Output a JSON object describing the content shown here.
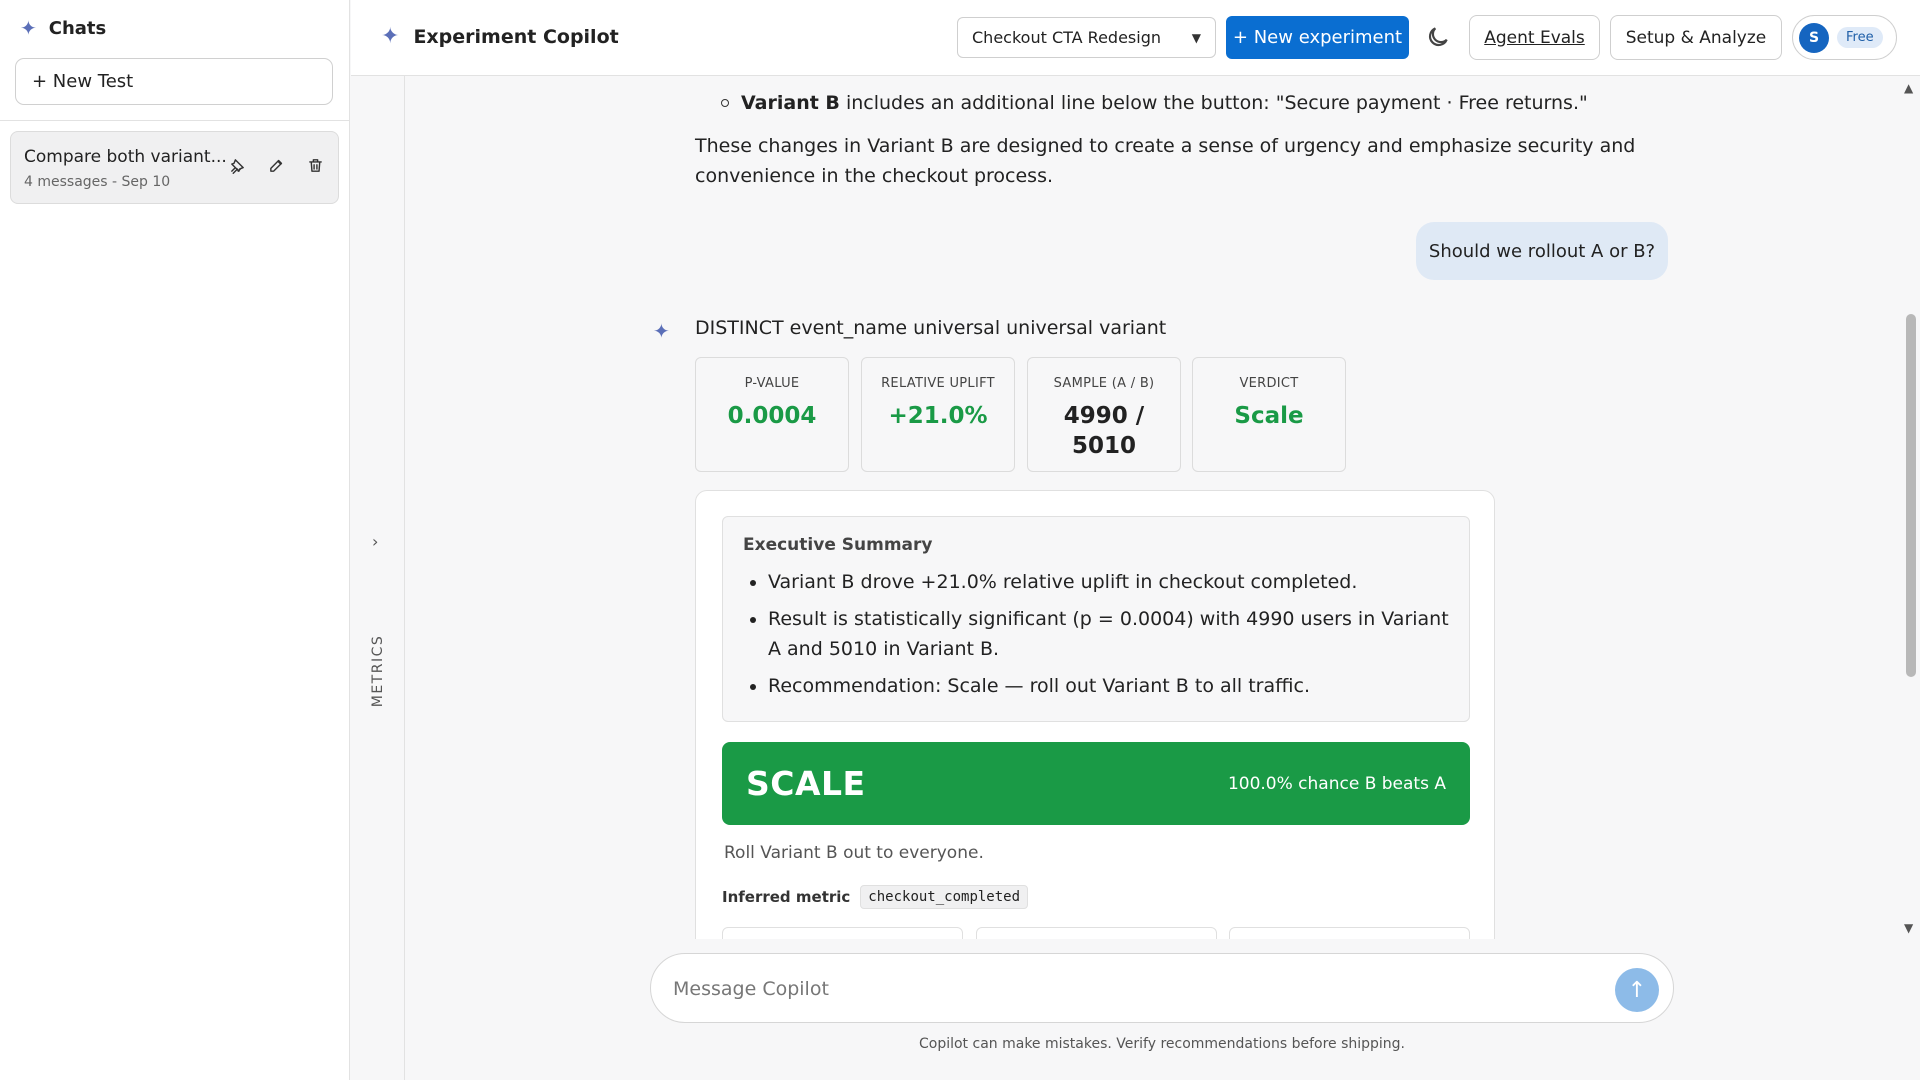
{
  "sidebar": {
    "title": "Chats",
    "new_test_label": "+ New Test",
    "chats": [
      {
        "title": "Compare both variant...",
        "subtitle": "4 messages - Sep 10"
      }
    ]
  },
  "rail": {
    "label": "METRICS",
    "chevron": "›"
  },
  "topbar": {
    "title": "Experiment Copilot",
    "experiment_select": "Checkout CTA Redesign",
    "new_experiment_label": "+ New experiment",
    "agent_evals_label": "Agent Evals",
    "setup_label": "Setup & Analyze",
    "avatar_initial": "S",
    "plan_badge": "Free"
  },
  "chat": {
    "variant_b_name": "Variant B",
    "variant_b_desc": " includes an additional line below the button: \"Secure payment · Free returns.\"",
    "summary_paragraph": "These changes in Variant B are designed to create a sense of urgency and emphasize security and convenience in the checkout process.",
    "user_message": "Should we rollout A or B?",
    "assistant_heading": "DISTINCT event_name universal universal variant",
    "stats": [
      {
        "label": "P-VALUE",
        "value": "0.0004"
      },
      {
        "label": "RELATIVE UPLIFT",
        "value": "+21.0%"
      },
      {
        "label": "SAMPLE (A / B)",
        "value": "4990 / 5010"
      },
      {
        "label": "VERDICT",
        "value": "Scale"
      }
    ],
    "executive_summary": {
      "title": "Executive Summary",
      "bullets": [
        "Variant B drove +21.0% relative uplift in checkout completed.",
        "Result is statistically significant (p = 0.0004) with 4990 users in Variant A and 5010 in Variant B.",
        "Recommendation: Scale — roll out Variant B to all traffic."
      ]
    },
    "verdict_banner": {
      "label": "SCALE",
      "chance": "100.0% chance B beats A"
    },
    "verdict_note": "Roll Variant B out to everyone.",
    "inferred_metric_label": "Inferred metric",
    "inferred_metric_value": "checkout_completed"
  },
  "composer": {
    "placeholder": "Message Copilot",
    "disclaimer": "Copilot can make mistakes. Verify recommendations before shipping."
  },
  "colors": {
    "primary": "#0a6ed1",
    "success": "#1a9a46",
    "user_bubble": "#dfe9f5",
    "sparkle": "#5b6fb8"
  }
}
